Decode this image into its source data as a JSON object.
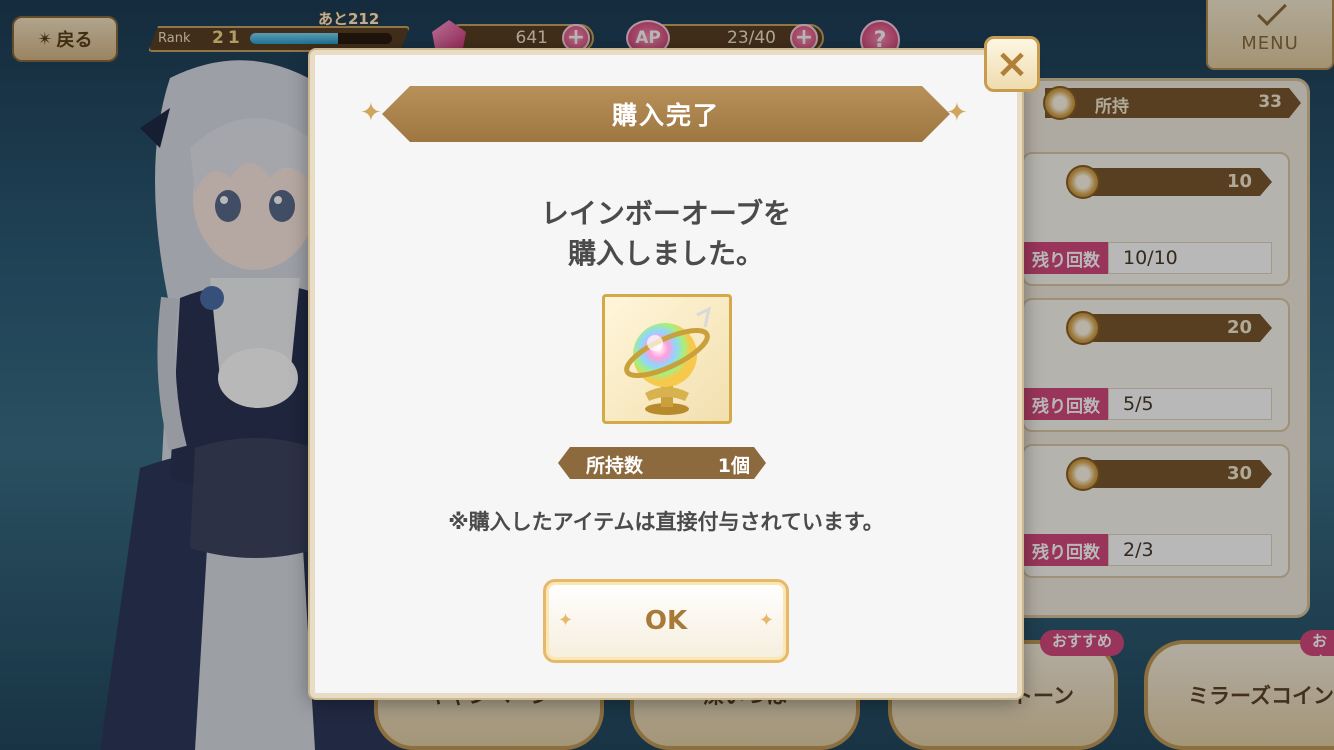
{
  "header": {
    "back_label": "戻る",
    "rank_label": "Rank",
    "rank_value": "21",
    "rank_next": "あと212",
    "rank_progress": 0.62,
    "gems": "641",
    "ap_label": "AP",
    "ap": "23/40",
    "help_label": "?",
    "menu_label": "MENU"
  },
  "shop": {
    "owned_label": "所持",
    "owned_value": "33",
    "remain_label": "残り回数",
    "items": [
      {
        "price": "10",
        "remain": "10/10"
      },
      {
        "price": "20",
        "remain": "5/5"
      },
      {
        "price": "30",
        "remain": "2/3"
      }
    ]
  },
  "bottom_tabs": {
    "badge": "おすすめ",
    "tab1": "キャンペーン",
    "tab2": "深いつは",
    "tab3": "トーン",
    "tab4": "ミラーズコイン"
  },
  "dialog": {
    "title": "購入完了",
    "message_line1": "レインボーオーブを",
    "message_line2": "購入しました。",
    "qty_label": "所持数",
    "qty_value": "1個",
    "note": "※購入したアイテムは直接付与されています。",
    "ok_label": "OK",
    "close_label": "×"
  },
  "colors": {
    "accent_gold": "#b8905a",
    "pink": "#d44a7d",
    "panel": "#f6f6f6"
  }
}
